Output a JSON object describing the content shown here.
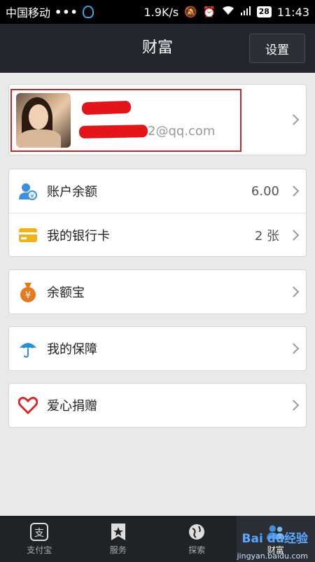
{
  "status_bar": {
    "carrier": "中国移动",
    "dots": "•••",
    "speed": "1.9K/s",
    "battery": "28",
    "time": "11:43"
  },
  "header": {
    "title": "财富",
    "settings_label": "设置"
  },
  "profile": {
    "email_suffix": "2@qq.com"
  },
  "rows": {
    "balance": {
      "label": "账户余额",
      "value": "6.00"
    },
    "bank_card": {
      "label": "我的银行卡",
      "value": "2 张"
    },
    "yuebao": {
      "label": "余额宝"
    },
    "protection": {
      "label": "我的保障"
    },
    "donation": {
      "label": "爱心捐赠"
    }
  },
  "tabbar": {
    "tabs": [
      {
        "label": "支付宝",
        "icon": "alipay-icon"
      },
      {
        "label": "服务",
        "icon": "star-icon"
      },
      {
        "label": "探索",
        "icon": "globe-icon"
      },
      {
        "label": "财富",
        "icon": "people-icon"
      }
    ]
  },
  "watermark": {
    "text": "Bai du经验",
    "url": "jingyan.baidu.com"
  },
  "colors": {
    "header_bg": "#23262d",
    "accent_red": "#c8232a",
    "balance_icon": "#3f8fdc",
    "bankcard_icon": "#f2b21b",
    "yuebao_icon": "#e67a1d",
    "protection_icon": "#2b8fd6",
    "donation_icon": "#d62a2a"
  }
}
